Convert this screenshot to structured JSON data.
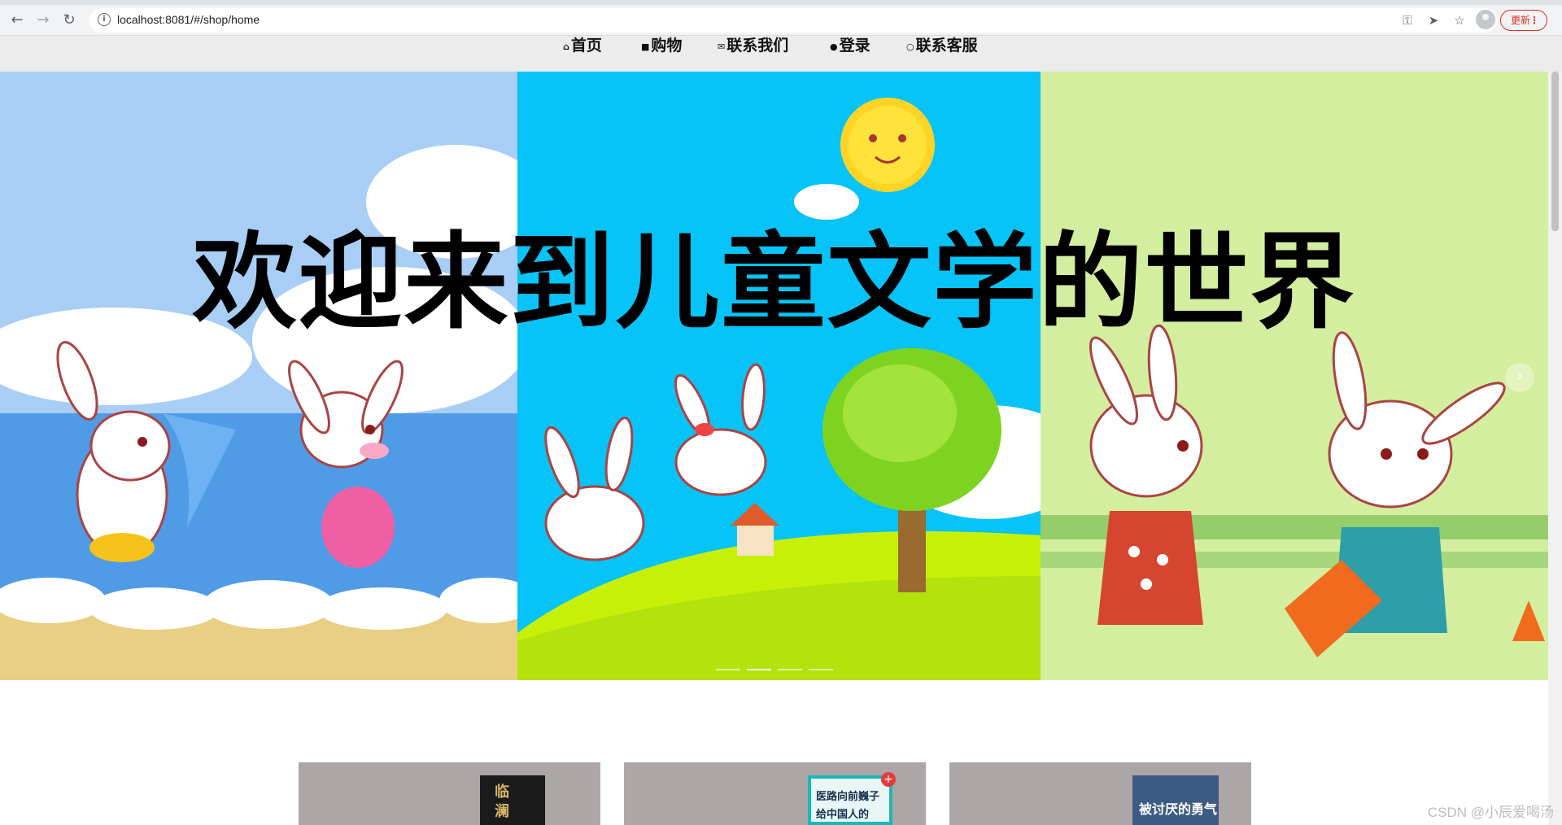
{
  "browser": {
    "url": "localhost:8081/#/shop/home",
    "update_label": "更新",
    "update_dots": "⋮",
    "back_icon": "←",
    "forward_icon": "→",
    "reload_icon": "↻",
    "info_icon": "i",
    "key_icon": "⚿",
    "send_icon": "➤",
    "star_icon": "☆"
  },
  "nav": {
    "items": [
      {
        "label": "首页",
        "icon": "home-icon"
      },
      {
        "label": "购物",
        "icon": "lock-icon"
      },
      {
        "label": "联系我们",
        "icon": "mail-icon"
      },
      {
        "label": "登录",
        "icon": "user-icon"
      },
      {
        "label": "联系客服",
        "icon": "chat-icon"
      }
    ]
  },
  "banner": {
    "title": "欢迎来到儿童文学的世界",
    "prev_arrow": "‹",
    "next_arrow": "›",
    "slides": 4,
    "active_slide": 1,
    "colors": [
      "#a8cef6",
      "#06c3f8",
      "#d4eea0"
    ]
  },
  "books": [
    {
      "cover_text": "临 澜",
      "cover_color": "#1b1b1b"
    },
    {
      "cover_text": "医路向前巍子 给中国人的",
      "cover_color": "#e9f6f6"
    },
    {
      "cover_text": "被讨厌的勇气",
      "cover_color": "#3d5a85"
    }
  ],
  "watermark": "CSDN @小辰爱喝汤"
}
